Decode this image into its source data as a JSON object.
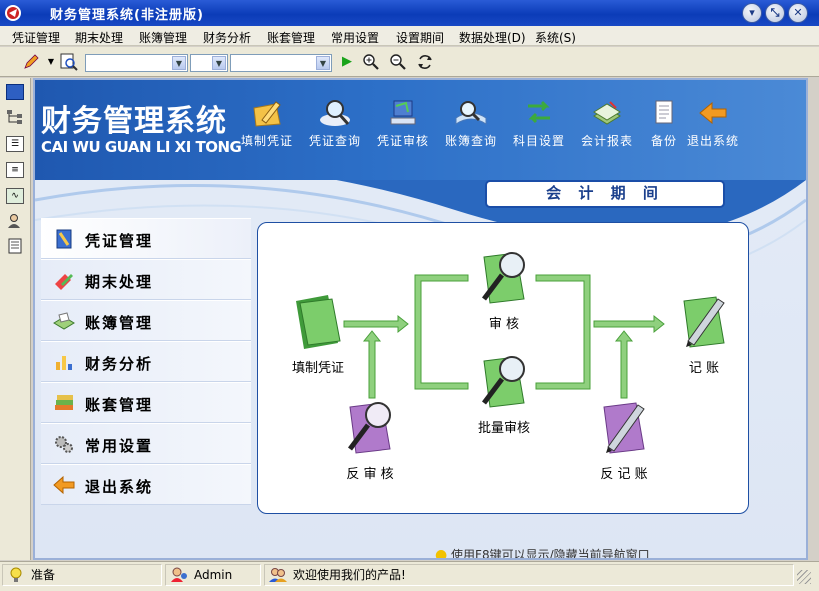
{
  "window": {
    "title": "财务管理系统(非注册版)",
    "buttons": [
      "min",
      "restore",
      "close"
    ]
  },
  "menu": [
    "凭证管理",
    "期末处理",
    "账簿管理",
    "财务分析",
    "账套管理",
    "常用设置",
    "设置期间",
    "数据处理(D)",
    "系统(S)"
  ],
  "toolbar": {
    "combo1": "",
    "combo2": "",
    "combo3": ""
  },
  "header": {
    "logo_cn": "财务管理系统",
    "logo_en": "CAI WU GUAN LI XI TONG",
    "nav": [
      "填制凭证",
      "凭证查询",
      "凭证审核",
      "账簿查询",
      "科目设置",
      "会计报表",
      "备份",
      "退出系统"
    ]
  },
  "period_label": "会 计 期 间",
  "sidemenu": [
    "凭证管理",
    "期末处理",
    "账簿管理",
    "财务分析",
    "账套管理",
    "常用设置",
    "退出系统"
  ],
  "flow": {
    "fill": "填制凭证",
    "audit": "审  核",
    "batch": "批量审核",
    "reverse_audit": "反  审  核",
    "post": "记  账",
    "reverse_post": "反  记  账"
  },
  "tip": "使用F8键可以显示/隐藏当前导航窗口",
  "status": {
    "ready": "准备",
    "user": "Admin",
    "welcome": "欢迎使用我们的产品!"
  },
  "colors": {
    "accent": "#1f58b0",
    "flow_green": "#59b24b"
  }
}
